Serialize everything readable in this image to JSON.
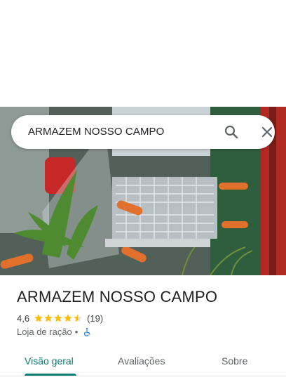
{
  "search": {
    "query": "ARMAZEM NOSSO CAMPO"
  },
  "place": {
    "name": "ARMAZEM NOSSO CAMPO",
    "rating": "4,6",
    "stars": 4.5,
    "reviews": "(19)",
    "category": "Loja de ração",
    "separator": "•"
  },
  "tabs": [
    {
      "label": "Visão geral",
      "active": true
    },
    {
      "label": "Avaliações",
      "active": false
    },
    {
      "label": "Sobre",
      "active": false
    }
  ],
  "colors": {
    "accent": "#0b7c72",
    "star": "#fbbc04",
    "accessibility": "#1a73e8"
  }
}
